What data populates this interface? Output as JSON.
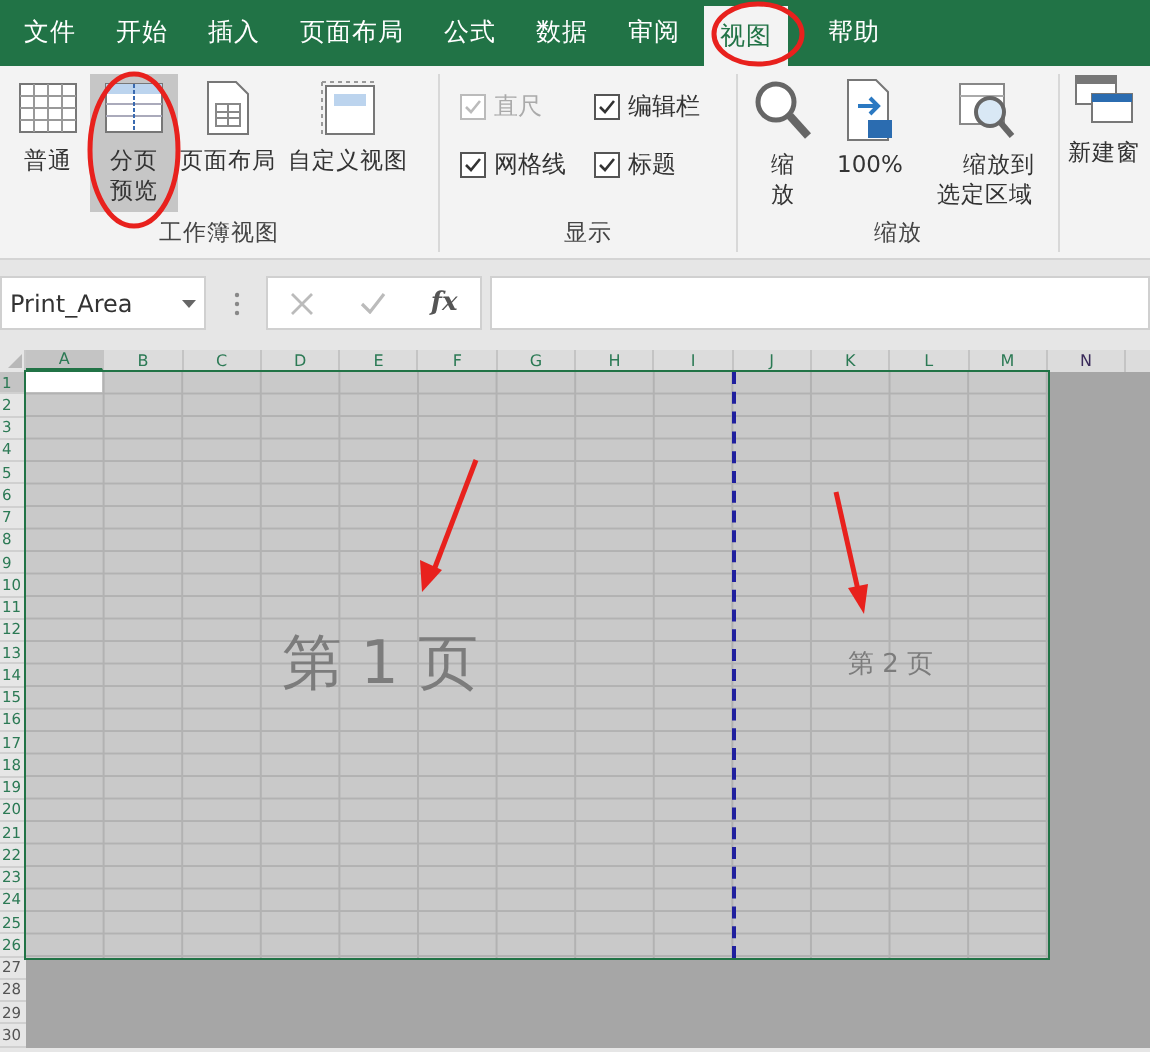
{
  "tabs": [
    {
      "label": "文件",
      "selected": false
    },
    {
      "label": "开始",
      "selected": false
    },
    {
      "label": "插入",
      "selected": false
    },
    {
      "label": "页面布局",
      "selected": false
    },
    {
      "label": "公式",
      "selected": false
    },
    {
      "label": "数据",
      "selected": false
    },
    {
      "label": "审阅",
      "selected": false
    },
    {
      "label": "视图",
      "selected": true
    },
    {
      "label": "帮助",
      "selected": false
    }
  ],
  "ribbon": {
    "workbook_views": {
      "label": "工作簿视图",
      "items": [
        {
          "kind": "normal",
          "label": "普通",
          "selected": false
        },
        {
          "kind": "pagebreak",
          "label": "分页预览",
          "selected": true
        },
        {
          "kind": "pagelayout",
          "label": "页面布局",
          "selected": false
        },
        {
          "kind": "custom",
          "label": "自定义视图",
          "selected": false
        }
      ]
    },
    "show": {
      "label": "显示",
      "items": [
        {
          "label": "直尺",
          "checked": true,
          "disabled": true
        },
        {
          "label": "编辑栏",
          "checked": true,
          "disabled": false
        },
        {
          "label": "网格线",
          "checked": true,
          "disabled": false
        },
        {
          "label": "标题",
          "checked": true,
          "disabled": false
        }
      ]
    },
    "zoom": {
      "label": "缩放",
      "items": [
        {
          "kind": "magnifier",
          "label": "缩放"
        },
        {
          "kind": "hundred",
          "label": "100%"
        },
        {
          "kind": "selection",
          "label": "缩放到选定区域"
        }
      ]
    },
    "window": {
      "items": [
        {
          "kind": "newwindow",
          "label": "新建窗"
        }
      ]
    }
  },
  "formula_bar": {
    "name_box": "Print_Area",
    "fx": "fx"
  },
  "sheet": {
    "columns": [
      {
        "label": "A",
        "selected": true,
        "in_print_area": true,
        "page_break_after": false
      },
      {
        "label": "B",
        "selected": false,
        "in_print_area": true,
        "page_break_after": false
      },
      {
        "label": "C",
        "selected": false,
        "in_print_area": true,
        "page_break_after": false
      },
      {
        "label": "D",
        "selected": false,
        "in_print_area": true,
        "page_break_after": false
      },
      {
        "label": "E",
        "selected": false,
        "in_print_area": true,
        "page_break_after": false
      },
      {
        "label": "F",
        "selected": false,
        "in_print_area": true,
        "page_break_after": false
      },
      {
        "label": "G",
        "selected": false,
        "in_print_area": true,
        "page_break_after": false
      },
      {
        "label": "H",
        "selected": false,
        "in_print_area": true,
        "page_break_after": false
      },
      {
        "label": "I",
        "selected": false,
        "in_print_area": true,
        "page_break_after": true
      },
      {
        "label": "J",
        "selected": false,
        "in_print_area": true,
        "page_break_after": false
      },
      {
        "label": "K",
        "selected": false,
        "in_print_area": true,
        "page_break_after": false
      },
      {
        "label": "L",
        "selected": false,
        "in_print_area": true,
        "page_break_after": false
      },
      {
        "label": "M",
        "selected": false,
        "in_print_area": true,
        "page_break_after": false
      },
      {
        "label": "N",
        "selected": false,
        "in_print_area": false,
        "page_break_after": false
      }
    ],
    "rows": [
      {
        "label": "1",
        "selected": true,
        "in_print_area": true
      },
      {
        "label": "2",
        "selected": false,
        "in_print_area": true
      },
      {
        "label": "3",
        "selected": false,
        "in_print_area": true
      },
      {
        "label": "4",
        "selected": false,
        "in_print_area": true
      },
      {
        "label": "5",
        "selected": false,
        "in_print_area": true
      },
      {
        "label": "6",
        "selected": false,
        "in_print_area": true
      },
      {
        "label": "7",
        "selected": false,
        "in_print_area": true
      },
      {
        "label": "8",
        "selected": false,
        "in_print_area": true
      },
      {
        "label": "9",
        "selected": false,
        "in_print_area": true
      },
      {
        "label": "10",
        "selected": false,
        "in_print_area": true
      },
      {
        "label": "11",
        "selected": false,
        "in_print_area": true
      },
      {
        "label": "12",
        "selected": false,
        "in_print_area": true
      },
      {
        "label": "13",
        "selected": false,
        "in_print_area": true
      },
      {
        "label": "14",
        "selected": false,
        "in_print_area": true
      },
      {
        "label": "15",
        "selected": false,
        "in_print_area": true
      },
      {
        "label": "16",
        "selected": false,
        "in_print_area": true
      },
      {
        "label": "17",
        "selected": false,
        "in_print_area": true
      },
      {
        "label": "18",
        "selected": false,
        "in_print_area": true
      },
      {
        "label": "19",
        "selected": false,
        "in_print_area": true
      },
      {
        "label": "20",
        "selected": false,
        "in_print_area": true
      },
      {
        "label": "21",
        "selected": false,
        "in_print_area": true
      },
      {
        "label": "22",
        "selected": false,
        "in_print_area": true
      },
      {
        "label": "23",
        "selected": false,
        "in_print_area": true
      },
      {
        "label": "24",
        "selected": false,
        "in_print_area": true
      },
      {
        "label": "25",
        "selected": false,
        "in_print_area": true
      },
      {
        "label": "26",
        "selected": false,
        "in_print_area": true
      },
      {
        "label": "27",
        "selected": false,
        "in_print_area": false
      },
      {
        "label": "28",
        "selected": false,
        "in_print_area": false
      },
      {
        "label": "29",
        "selected": false,
        "in_print_area": false
      },
      {
        "label": "30",
        "selected": false,
        "in_print_area": false
      }
    ],
    "pages": [
      {
        "label": "第 1 页"
      },
      {
        "label": "第 2 页"
      }
    ]
  }
}
